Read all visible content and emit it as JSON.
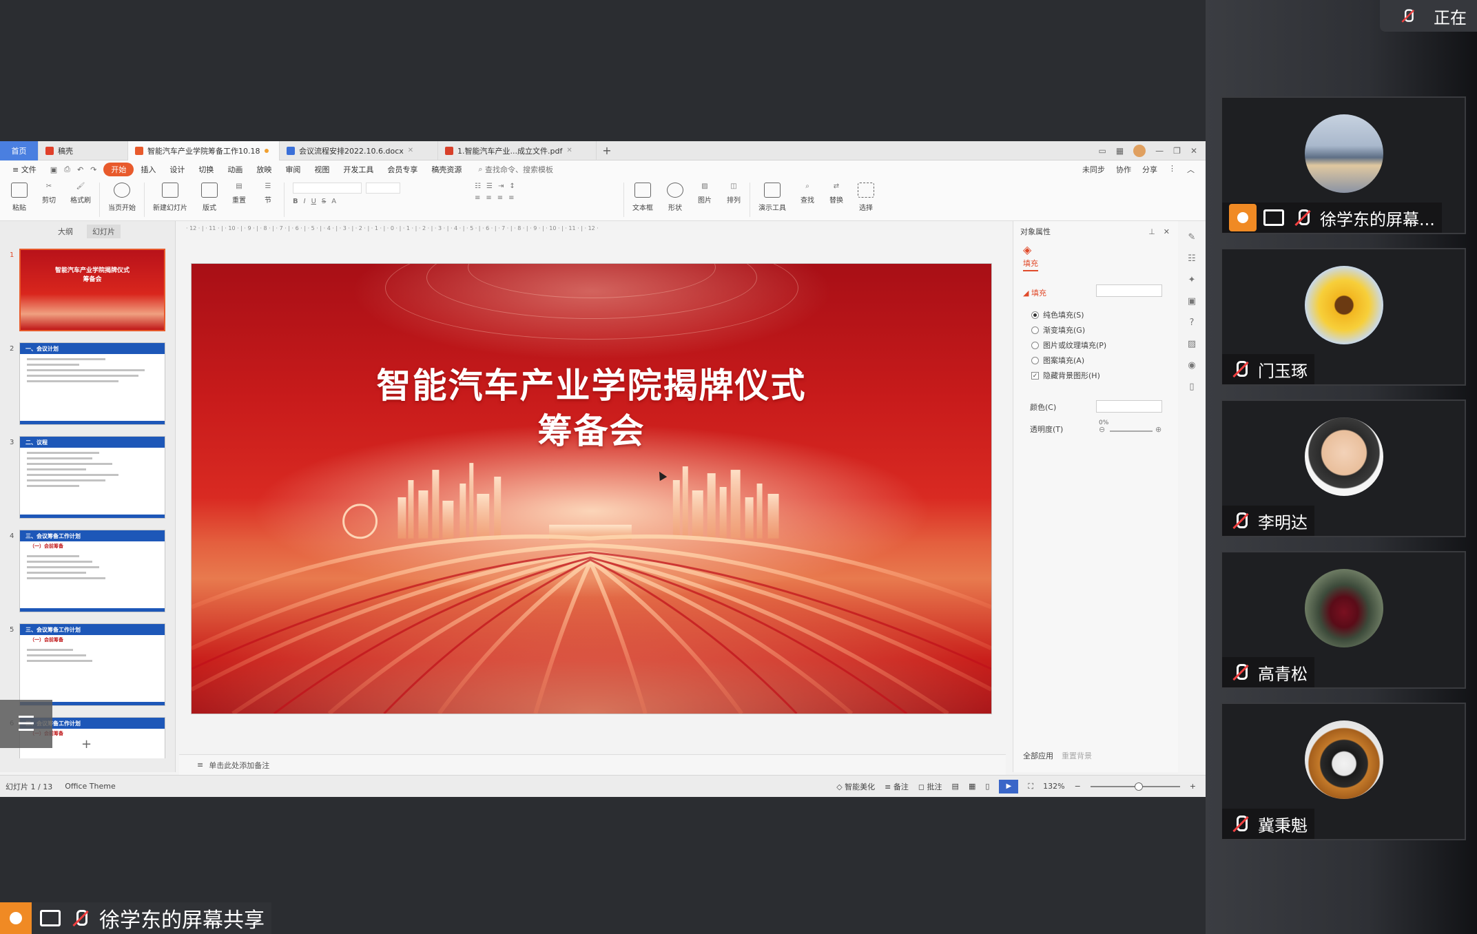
{
  "top_chip": {
    "text": "正在"
  },
  "app": {
    "tabs": [
      {
        "label": "首页"
      },
      {
        "label": "稿壳"
      },
      {
        "label": "智能汽车产业学院筹备工作10.18"
      },
      {
        "label": "会议流程安排2022.10.6.docx"
      },
      {
        "label": "1.智能汽车产业...成立文件.pdf"
      }
    ],
    "add_tab": "+",
    "menu": {
      "file": "文件",
      "items": [
        "开始",
        "插入",
        "设计",
        "切换",
        "动画",
        "放映",
        "审阅",
        "视图",
        "开发工具",
        "会员专享",
        "稿壳资源"
      ],
      "search": "查找命令、搜索模板",
      "right": [
        "未同步",
        "协作",
        "分享"
      ]
    },
    "ribbon": [
      {
        "label": "粘贴"
      },
      {
        "label": "剪切"
      },
      {
        "label": "格式刷"
      },
      {
        "label": "当页开始"
      },
      {
        "label": "新建幻灯片"
      },
      {
        "label": "版式"
      },
      {
        "label": "重置"
      },
      {
        "label": "节"
      },
      {
        "label": "文本框"
      },
      {
        "label": "形状"
      },
      {
        "label": "图片"
      },
      {
        "label": "排列"
      },
      {
        "label": "演示工具"
      },
      {
        "label": "查找"
      },
      {
        "label": "替换"
      },
      {
        "label": "选择"
      }
    ],
    "left_panel": {
      "tab_outline": "大纲",
      "tab_slides": "幻灯片"
    },
    "thumbnails": [
      {
        "num": "1",
        "title": "智能汽车产业学院揭牌仪式\n筹备会"
      },
      {
        "num": "2",
        "header": "一、会议计划"
      },
      {
        "num": "3",
        "header": "二、议程"
      },
      {
        "num": "4",
        "header": "三、会议筹备工作计划",
        "sub": "（一）会前筹备"
      },
      {
        "num": "5",
        "header": "三、会议筹备工作计划",
        "sub": "（一）会前筹备"
      },
      {
        "num": "6",
        "header": "三、会议筹备工作计划",
        "sub": "（一）会前筹备"
      }
    ],
    "slide": {
      "title_line1": "智能汽车产业学院揭牌仪式",
      "title_line2": "筹备会"
    },
    "notes_placeholder": "单击此处添加备注",
    "property_pane": {
      "title": "对象属性",
      "tab": "填充",
      "fill_header": "填充",
      "options": [
        "纯色填充(S)",
        "渐变填充(G)",
        "图片或纹理填充(P)",
        "图案填充(A)",
        "隐藏背景图形(H)"
      ],
      "color_label": "颜色(C)",
      "transparency_label": "透明度(T)",
      "transparency_value": "0%",
      "apply_all": "全部应用",
      "reset_bg": "重置背景"
    },
    "status": {
      "slide_index": "幻灯片 1 / 13",
      "theme": "Office Theme",
      "beautify": "智能美化",
      "notes": "备注",
      "comments": "批注",
      "zoom": "132%"
    }
  },
  "participants": [
    {
      "name": "徐学东的屏幕...",
      "sharing": true
    },
    {
      "name": "门玉琢"
    },
    {
      "name": "李明达"
    },
    {
      "name": "高青松"
    },
    {
      "name": "冀秉魁"
    }
  ],
  "bottom_share_label": "徐学东的屏幕共享"
}
